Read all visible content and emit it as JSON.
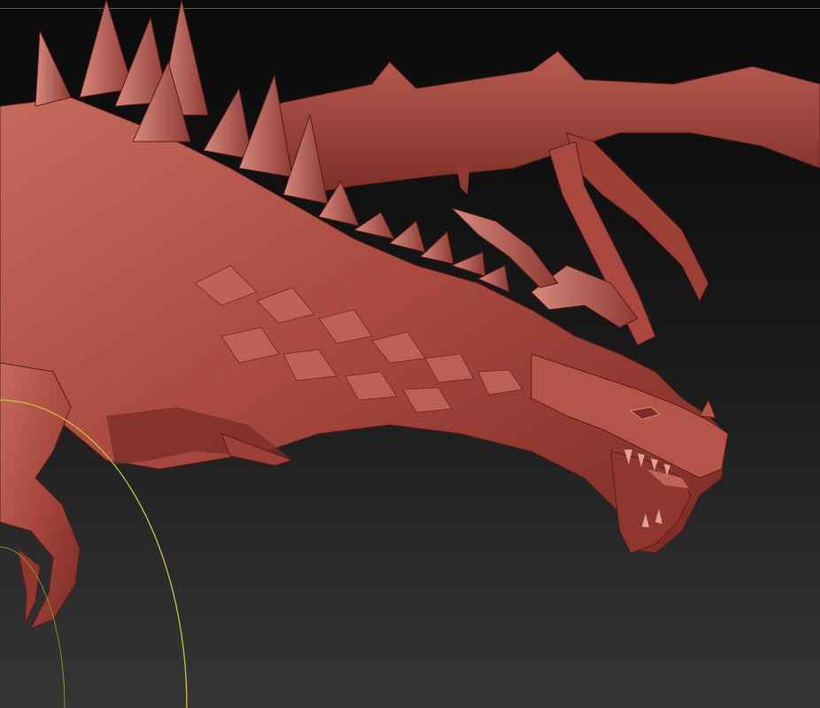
{
  "app": {
    "viewport_label": "",
    "background": "#1a1a1a"
  },
  "model": {
    "material_color": "#a8483f",
    "highlight_color": "#d88a7e",
    "shadow_color": "#5a1c17"
  },
  "brush": {
    "icon": "brush-cursor-icon",
    "outer_ring_color": "#c8c23a",
    "inner_ring_color": "#8a8a2a"
  },
  "canvas": {
    "top_rule_color": "#5a5a5a"
  }
}
